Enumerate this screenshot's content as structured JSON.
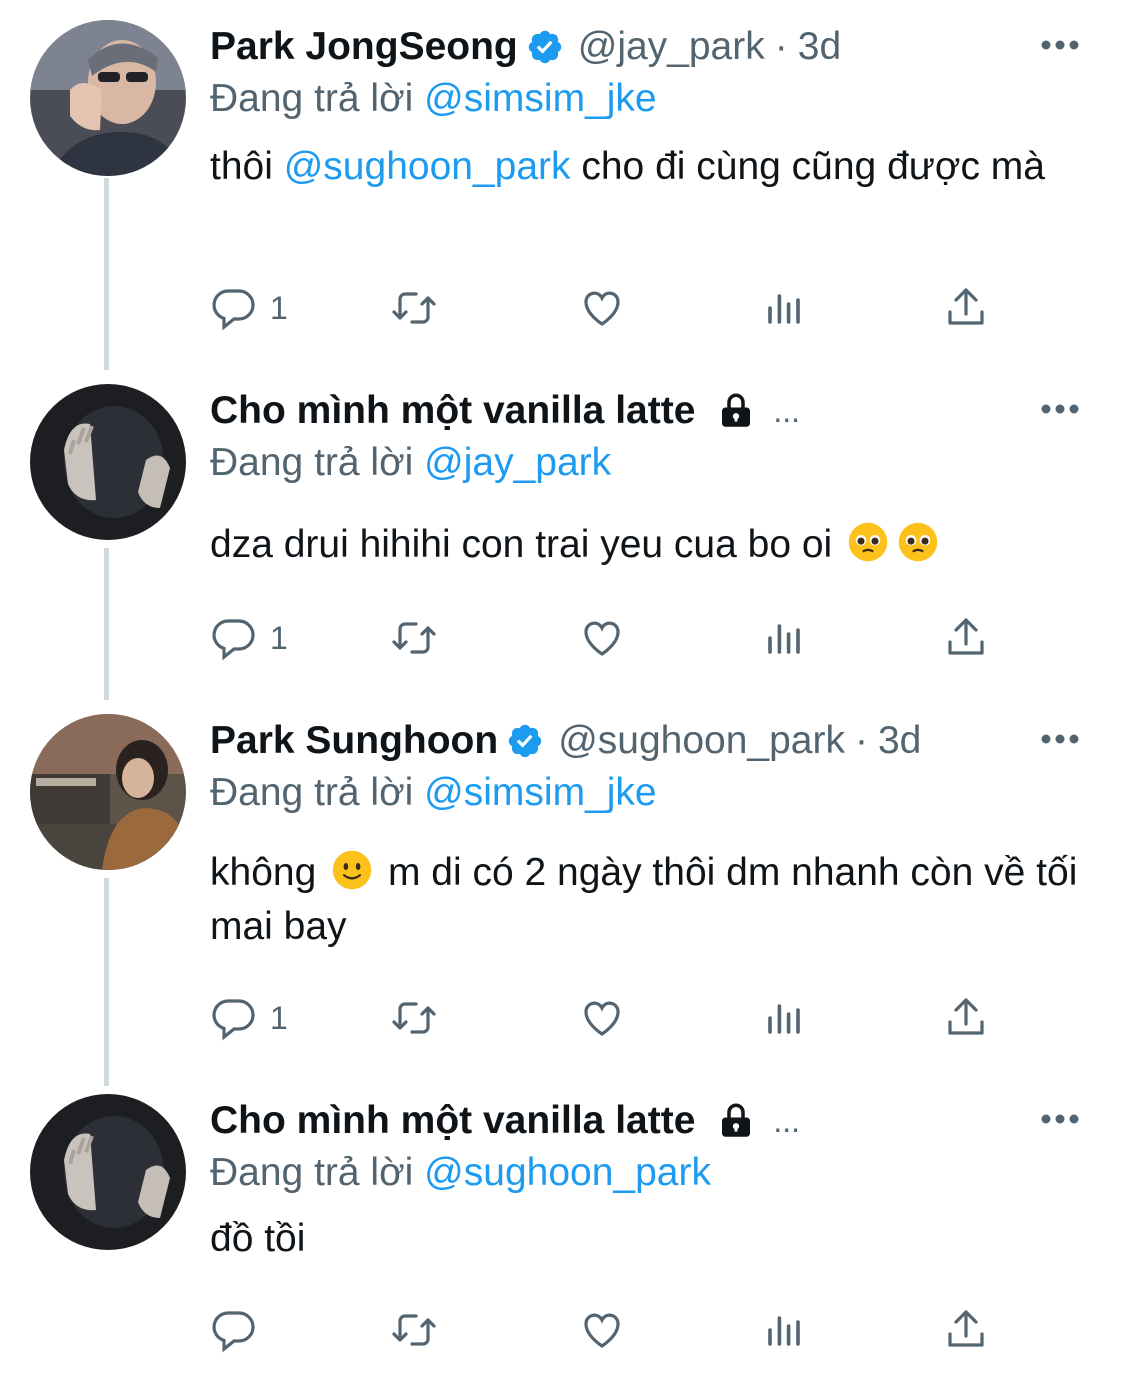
{
  "tweets": [
    {
      "name": "Park JongSeong",
      "verified": true,
      "handle": "@jay_park",
      "separator": "·",
      "time": "3d",
      "reply_prefix": "Đang trả lời",
      "reply_to": "@simsim_jke",
      "text_before": "thôi ",
      "text_mention": "@sughoon_park",
      "text_after": " cho đi cùng cũng được mà",
      "reply_count": "1"
    },
    {
      "name": "Cho mình một vanilla latte",
      "protected": true,
      "ellipsis": "...",
      "reply_prefix": "Đang trả lời",
      "reply_to": "@jay_park",
      "text": "dza drui hihihi con trai yeu cua bo oi",
      "emoji": [
        "pleading-face",
        "pleading-face"
      ],
      "reply_count": "1"
    },
    {
      "name": "Park Sunghoon",
      "verified": true,
      "handle": "@sughoon_park",
      "separator": "·",
      "time": "3d",
      "reply_prefix": "Đang trả lời",
      "reply_to": "@simsim_jke",
      "text_before": "không",
      "emoji": [
        "slightly-smiling-face"
      ],
      "text_after": " m di có 2 ngày thôi dm nhanh còn về tối mai bay",
      "reply_count": "1"
    },
    {
      "name": "Cho mình một vanilla latte",
      "protected": true,
      "ellipsis": "...",
      "reply_prefix": "Đang trả lời",
      "reply_to": "@sughoon_park",
      "text": "đồ tồi",
      "reply_count": ""
    }
  ],
  "colors": {
    "accent": "#1d9bf0",
    "secondary_text": "#536471",
    "primary_text": "#0f1419",
    "thread_line": "#cfd9de"
  }
}
